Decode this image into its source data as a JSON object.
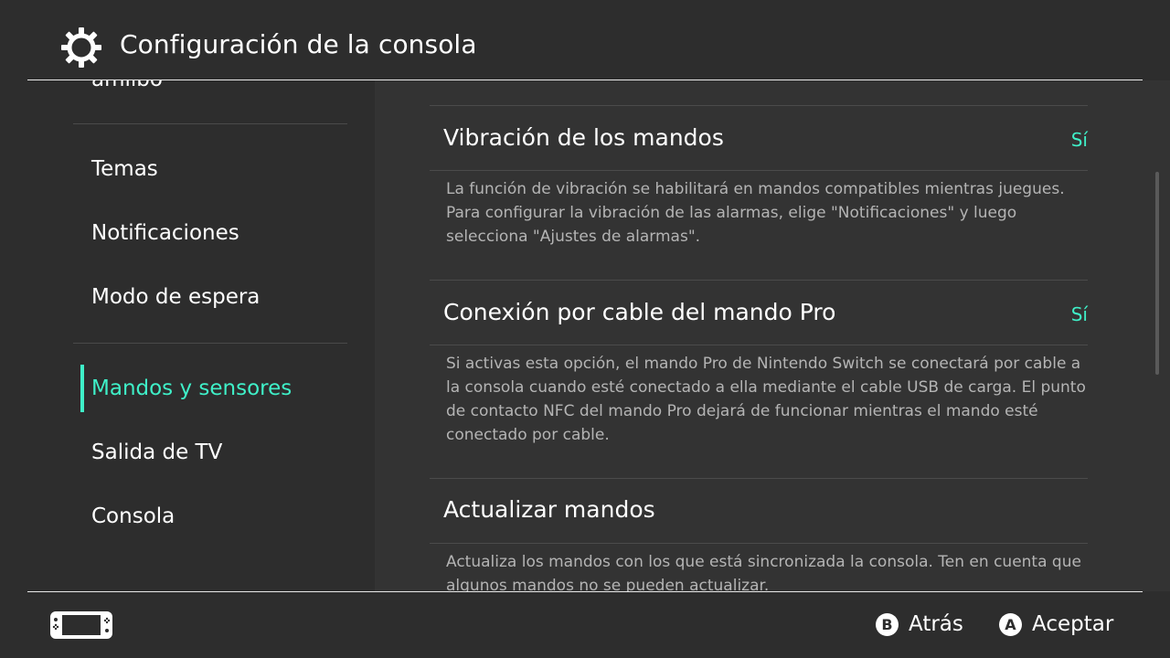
{
  "header": {
    "title": "Configuración de la consola",
    "icon": "gear-icon"
  },
  "sidebar": {
    "cut_item": "amiibo",
    "items": [
      {
        "label": "Temas"
      },
      {
        "label": "Notificaciones"
      },
      {
        "label": "Modo de espera"
      },
      {
        "label": "Mandos y sensores",
        "active": true
      },
      {
        "label": "Salida de TV"
      },
      {
        "label": "Consola"
      }
    ]
  },
  "content": {
    "options": [
      {
        "title": "Vibración de los mandos",
        "value": "Sí",
        "description": "La función de vibración se habilitará en mandos compatibles mientras juegues. Para configurar la vibración de las alarmas, elige \"Notificaciones\" y luego selecciona \"Ajustes de alarmas\"."
      },
      {
        "title": "Conexión por cable del mando Pro",
        "value": "Sí",
        "description": "Si activas esta opción, el mando Pro de Nintendo Switch se conectará por cable a la consola cuando esté conectado a ella mediante el cable USB de carga. El punto de contacto NFC del mando Pro dejará de funcionar mientras el mando esté conectado por cable."
      },
      {
        "title": "Actualizar mandos",
        "value": "",
        "description": "Actualiza los mandos con los que está sincronizada la consola. Ten en cuenta que algunos mandos no se pueden actualizar."
      }
    ]
  },
  "footer": {
    "console_icon": "switch-console-icon",
    "back": {
      "button": "B",
      "label": "Atrás"
    },
    "accept": {
      "button": "A",
      "label": "Aceptar"
    }
  },
  "colors": {
    "accent": "#3ff0c8",
    "background": "#2d2d2d",
    "panel": "#333333"
  }
}
